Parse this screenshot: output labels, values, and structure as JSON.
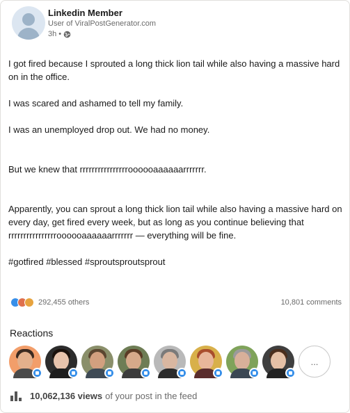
{
  "author": {
    "name": "Linkedin Member",
    "subtitle": "User of ViralPostGenerator.com",
    "time": "3h •"
  },
  "post": {
    "p1": "I got fired because I sprouted a long thick lion tail while also having a massive hard on in the office.",
    "p2": "I was scared and ashamed to tell my family.",
    "p3": "I was an unemployed drop out. We had no money.",
    "p4": "But we knew that rrrrrrrrrrrrrrrroooooaaaaaarrrrrrr.",
    "p5": "Apparently, you can sprout a long thick lion tail while also having a massive hard on every day, get fired every week, but as long as you continue believing that rrrrrrrrrrrrrrrroooooaaaaaarrrrrrr — everything will be fine.",
    "hashtags": "#gotfired #blessed #sproutsproutsprout"
  },
  "social": {
    "reactions_count": "292,455 others",
    "comments": "10,801 comments"
  },
  "reactions": {
    "title": "Reactions",
    "more_label": "..."
  },
  "views": {
    "count": "10,062,136 views",
    "suffix": "of your post in the feed"
  },
  "colors": {
    "like_blue": "#378fe9",
    "celebrate_green": "#44712e",
    "love_red": "#df704d",
    "support_gold": "#e7a33e"
  }
}
